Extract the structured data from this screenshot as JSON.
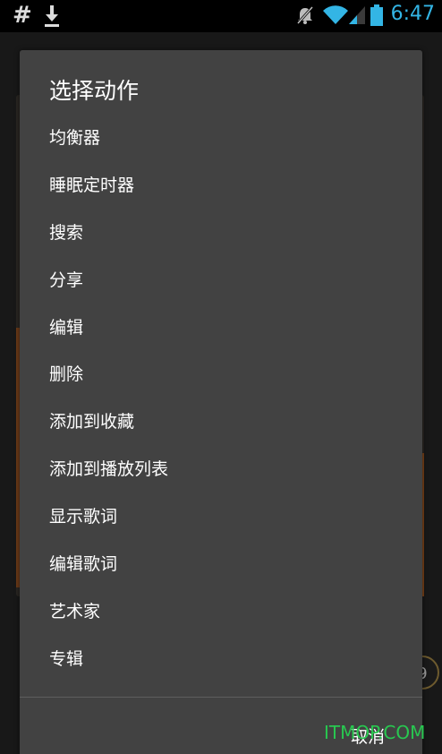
{
  "status_bar": {
    "left_icon_text": "#",
    "time": "6:47",
    "icons": [
      "hash-icon",
      "download-icon",
      "mute-icon",
      "wifi-icon",
      "signal-icon",
      "battery-icon"
    ],
    "time_color": "#33b5e5"
  },
  "background": {
    "knob_label": "9"
  },
  "dialog": {
    "title": "选择动作",
    "items": [
      {
        "label": "均衡器"
      },
      {
        "label": "睡眠定时器"
      },
      {
        "label": "搜索"
      },
      {
        "label": "分享"
      },
      {
        "label": "编辑"
      },
      {
        "label": "删除"
      },
      {
        "label": "添加到收藏"
      },
      {
        "label": "添加到播放列表"
      },
      {
        "label": "显示歌词"
      },
      {
        "label": "编辑歌词"
      },
      {
        "label": "艺术家"
      },
      {
        "label": "专辑"
      }
    ],
    "cancel_label": "取消",
    "background_color": "#424242"
  },
  "watermark": {
    "text": "ITMOP.COM",
    "color": "#28c850"
  }
}
